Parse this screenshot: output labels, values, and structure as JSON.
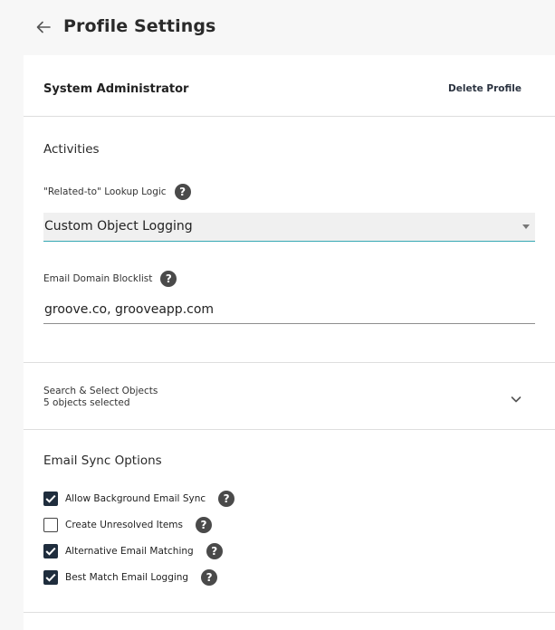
{
  "header": {
    "title": "Profile Settings"
  },
  "profile": {
    "name": "System Administrator",
    "delete_label": "Delete Profile"
  },
  "activities": {
    "section_title": "Activities",
    "lookup_label": "\"Related-to\" Lookup Logic",
    "lookup_value": "Custom Object Logging",
    "blocklist_label": "Email Domain Blocklist",
    "blocklist_value": "groove.co, grooveapp.com"
  },
  "search_select": {
    "title": "Search & Select Objects",
    "subtitle": "5 objects selected"
  },
  "email_sync": {
    "section_title": "Email Sync Options",
    "options": [
      {
        "label": "Allow Background Email Sync",
        "checked": true
      },
      {
        "label": "Create Unresolved Items",
        "checked": false
      },
      {
        "label": "Alternative Email Matching",
        "checked": true
      },
      {
        "label": "Best Match Email Logging",
        "checked": true
      }
    ]
  },
  "icons": {
    "back": "back-arrow-icon",
    "help": "question-mark-icon",
    "expand": "chevron-down-icon",
    "check": "checkmark-icon"
  },
  "colors": {
    "accent_underline": "#35a7b3",
    "checkbox_fill": "#1f2d3d",
    "help_icon": "#4a4a4a"
  }
}
